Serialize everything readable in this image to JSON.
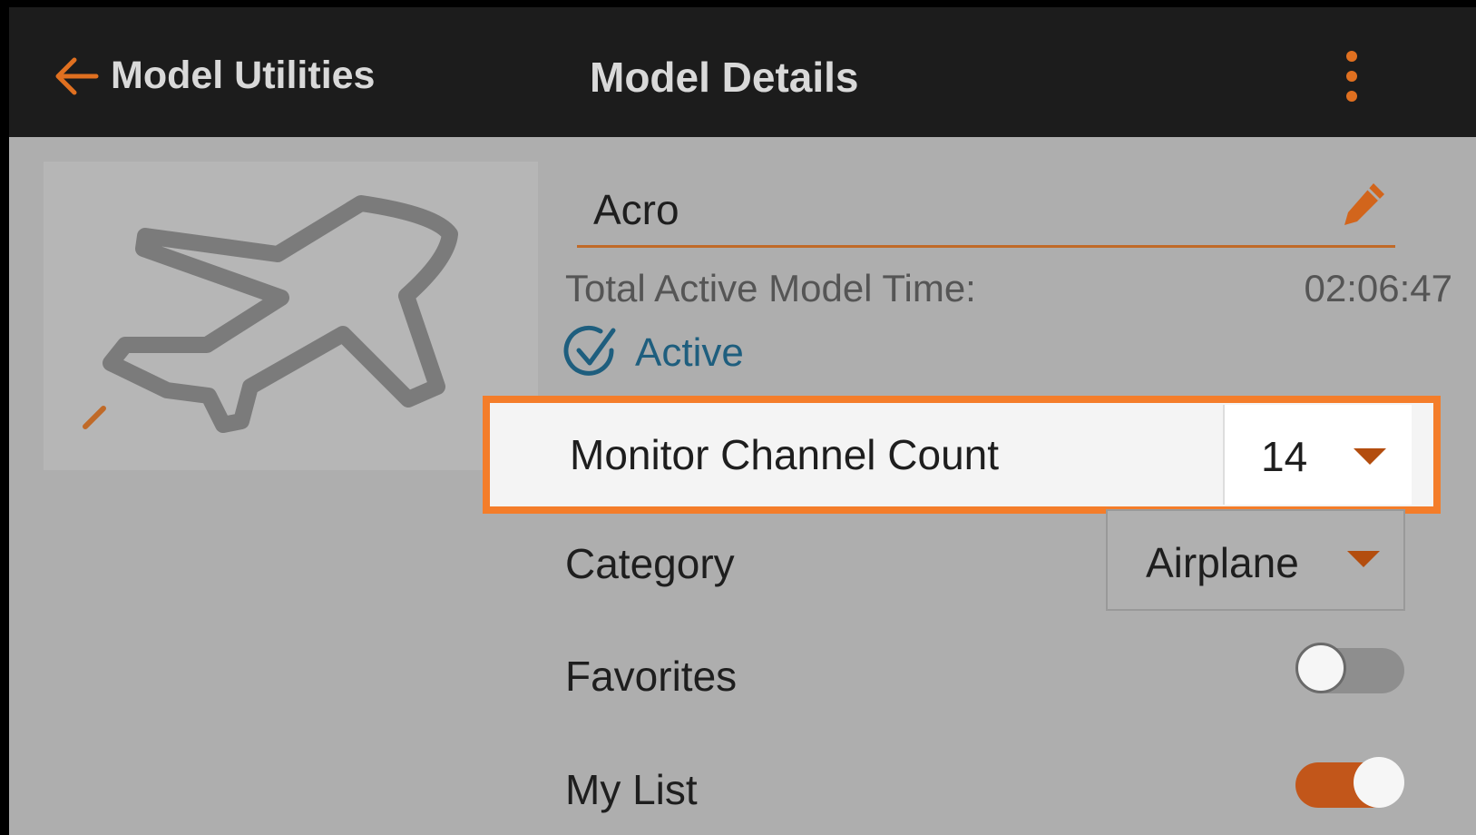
{
  "header": {
    "back_label": "Model Utilities",
    "title": "Model Details",
    "back_icon": "arrow-left-icon",
    "menu_icon": "more-vertical-icon"
  },
  "model": {
    "image_icon": "airplane-icon",
    "name": "Acro",
    "edit_icon": "pencil-icon",
    "time_label": "Total Active Model Time:",
    "time_value": "02:06:47",
    "active_label": "Active",
    "active_checked": true
  },
  "settings": {
    "monitor_channel_count": {
      "label": "Monitor Channel Count",
      "value": "14"
    },
    "category": {
      "label": "Category",
      "value": "Airplane"
    },
    "favorites": {
      "label": "Favorites",
      "on": false
    },
    "my_list": {
      "label": "My List",
      "on": true
    }
  },
  "colors": {
    "accent": "#e07020",
    "highlight_border": "#f47d2a",
    "header_bg": "#1c1c1c",
    "screen_bg": "#aeaeae",
    "active_color": "#1e5e7e"
  }
}
